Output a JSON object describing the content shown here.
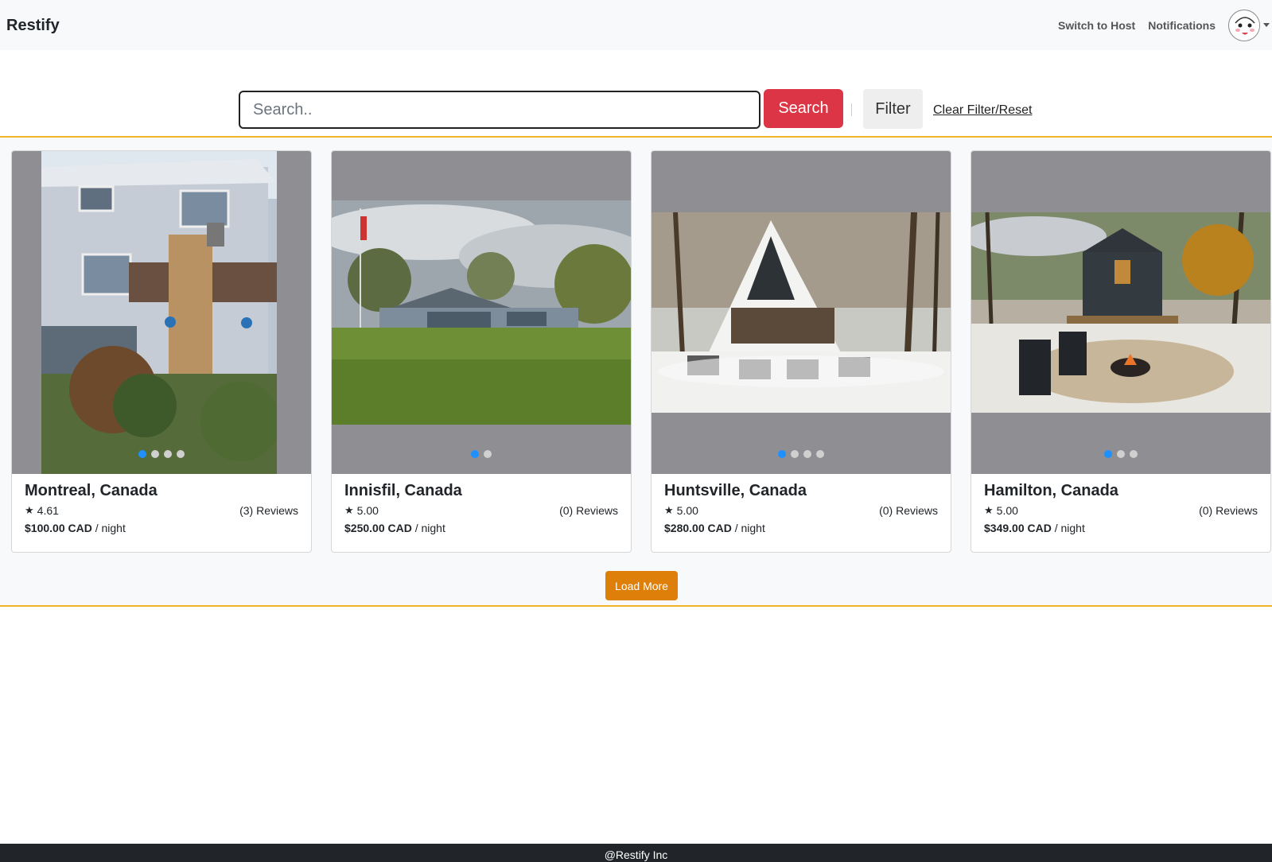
{
  "navbar": {
    "brand": "Restify",
    "switch_to_host": "Switch to Host",
    "notifications": "Notifications"
  },
  "search": {
    "placeholder": "Search..",
    "button_label": "Search",
    "filter_label": "Filter",
    "clear_label": "Clear Filter/Reset"
  },
  "listings": [
    {
      "city": "Montreal, Canada",
      "rating": "4.61",
      "reviews": "(3) Reviews",
      "price": "$100.00 CAD",
      "per": "/ night",
      "image_count": 4,
      "active_image": 0
    },
    {
      "city": "Innisfil, Canada",
      "rating": "5.00",
      "reviews": "(0) Reviews",
      "price": "$250.00 CAD",
      "per": "/ night",
      "image_count": 2,
      "active_image": 0
    },
    {
      "city": "Huntsville, Canada",
      "rating": "5.00",
      "reviews": "(0) Reviews",
      "price": "$280.00 CAD",
      "per": "/ night",
      "image_count": 4,
      "active_image": 0
    },
    {
      "city": "Hamilton, Canada",
      "rating": "5.00",
      "reviews": "(0) Reviews",
      "price": "$349.00 CAD",
      "per": "/ night",
      "image_count": 3,
      "active_image": 0
    }
  ],
  "load_more_label": "Load More",
  "footer": {
    "text": "@Restify Inc"
  },
  "colors": {
    "search_button": "#dc3545",
    "load_more": "#de7f0a",
    "accent_border": "#f0b429",
    "active_dot": "#1e90ff",
    "footer_bg": "#212529"
  },
  "icons": {
    "rating": "star-icon",
    "account": "avatar",
    "menu": "caret-down-icon"
  }
}
